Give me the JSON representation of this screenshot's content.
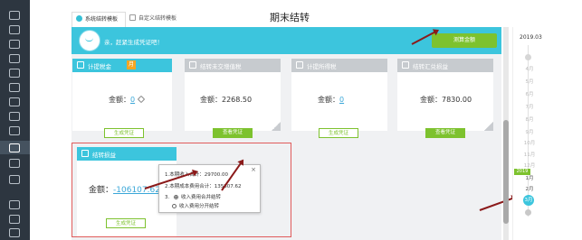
{
  "tabs": [
    {
      "label": "系统结转模板",
      "active": true
    },
    {
      "label": "自定义结转模板",
      "active": false
    }
  ],
  "page_title": "期末结转",
  "banner": {
    "text": "亲，赶紧生成凭证吧！",
    "button_label": "测算金额"
  },
  "cards": [
    {
      "title": "计提税金",
      "badge": "月",
      "amount_label": "金额：",
      "amount": "0",
      "amount_link": true,
      "button_label": "生成凭证",
      "button_style": "outline",
      "header_color": "#3cc5dd"
    },
    {
      "title": "结转未交增值税",
      "amount_label": "金额：",
      "amount": "2268.50",
      "amount_link": false,
      "button_label": "查看凭证",
      "button_style": "solid"
    },
    {
      "title": "计提所得税",
      "amount_label": "金额：",
      "amount": "0",
      "amount_link": true,
      "button_label": "生成凭证",
      "button_style": "outline"
    },
    {
      "title": "结转汇兑损益",
      "amount_label": "金额：",
      "amount": "7830.00",
      "amount_link": false,
      "button_label": "查看凭证",
      "button_style": "solid"
    },
    {
      "title": "结转损益",
      "amount_label": "金额：",
      "amount": "-106107.62",
      "amount_link": true,
      "button_label": "生成凭证",
      "button_style": "outline",
      "header_color": "#3cc5dd"
    }
  ],
  "popup": {
    "line1": "1.本期收入合计：29700.00",
    "line2": "2.本期成本费用合计：135807.62",
    "line3_prefix": "3.",
    "option1": "收入费用合并结转",
    "option2": "收入费用分开结转",
    "close": "×"
  },
  "timeline": {
    "year_top": "2019.03",
    "year_badge": "2019",
    "months": [
      "4月",
      "5月",
      "6月",
      "7月",
      "8月",
      "9月",
      "10月",
      "11月",
      "12月",
      "1月",
      "2月",
      "3月"
    ],
    "current": "3月"
  },
  "colors": {
    "accent": "#3cc5dd",
    "green": "#7dc22e",
    "highlight_box": "#e05b5b",
    "arrow": "#8b1a1a"
  }
}
